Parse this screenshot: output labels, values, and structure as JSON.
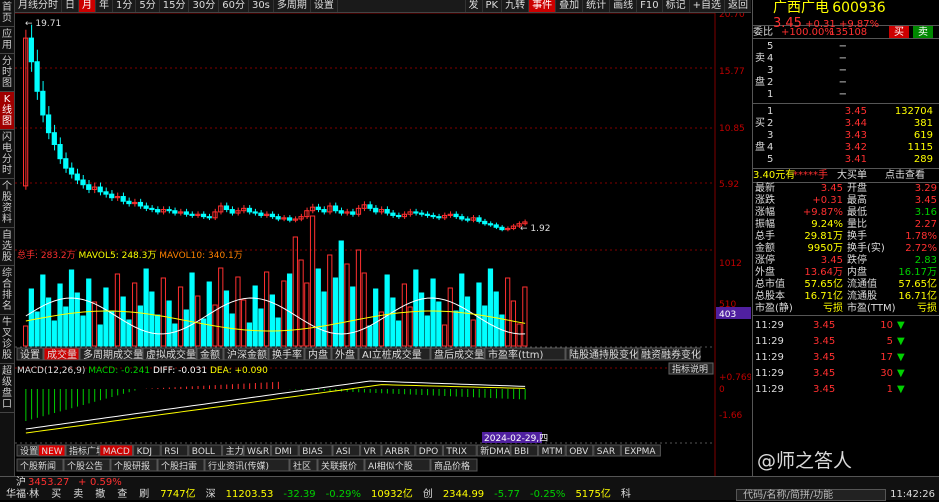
{
  "leftbar": [
    "首页",
    "应用",
    "分时图",
    "K线图",
    "闪电分时",
    "个股资料",
    "自选股",
    "综合排名",
    "牛叉诊股",
    "超级盘口"
  ],
  "toolbar": {
    "left": [
      "月线分时",
      "日",
      "月",
      "年",
      "1分",
      "5分",
      "15分",
      "30分",
      "60分",
      "30s",
      "多周期",
      "设置"
    ],
    "right": [
      "发",
      "PK",
      "九转",
      "事件",
      "叠加",
      "统计",
      "画线",
      "F10",
      "标记",
      "+自选",
      "返回"
    ]
  },
  "price_axis": [
    "20.70",
    "15.77",
    "10.85",
    "5.92"
  ],
  "high_label": "19.71",
  "low_label": "1.92",
  "vol_info": {
    "total": "总手: 283.2万",
    "ma5": "MAVOL5: 248.3万",
    "ma10": "MAVOL10: 340.1万"
  },
  "vol_axis": [
    "1012",
    "510",
    "403"
  ],
  "ind_tabs": [
    "设置",
    "成交量",
    "多周期成交量",
    "虚拟成交量",
    "金额",
    "沪深金额",
    "换手率",
    "内盘",
    "外盘",
    "AI立桩成交量",
    "盘后成交量",
    "市盈率(ttm)",
    "陆股通持股变化",
    "融资融券变化"
  ],
  "macd_info": {
    "title": "MACD(12,26,9)",
    "macd": "MACD: -0.241",
    "diff": "DIFF: -0.031",
    "dea": "DEA: +0.090"
  },
  "macd_axis": [
    "+0.769",
    "0",
    "-1.66"
  ],
  "macd_btn": "指标说明",
  "date_cursor": "2024-02-29,四",
  "bottom_tabs": [
    "设置",
    "NEW",
    "指标广场",
    "MACD",
    "KDJ",
    "RSI",
    "BOLL",
    "主力",
    "W&R",
    "DMI",
    "BIAS",
    "ASI",
    "VR",
    "ARBR",
    "DPO",
    "TRIX",
    "新DMA",
    "BBI",
    "MTM",
    "OBV",
    "SAR",
    "EXPMA"
  ],
  "news_tabs": [
    "个股新闻",
    "个股公告",
    "个股研报",
    "个股扫雷",
    "行业资讯(传媒)",
    "社区",
    "关联报价",
    "AI相似个股",
    "商品价格"
  ],
  "stock": {
    "name": "广西广电",
    "code": "600936",
    "price": "3.45",
    "change": "+0.31",
    "pct": "+9.87%"
  },
  "order": {
    "label": "委比",
    "ratio": "+100.00%",
    "diff": "135108",
    "buy": "买",
    "sell": "卖"
  },
  "asks": [
    [
      "5",
      "",
      ""
    ],
    [
      "4",
      "",
      ""
    ],
    [
      "3",
      "",
      ""
    ],
    [
      "2",
      "",
      ""
    ],
    [
      "1",
      "",
      ""
    ]
  ],
  "ask_mark": "−",
  "bids": [
    [
      "1",
      "3.45",
      "132704"
    ],
    [
      "2",
      "3.44",
      "381"
    ],
    [
      "3",
      "3.43",
      "619"
    ],
    [
      "4",
      "3.42",
      "1115"
    ],
    [
      "5",
      "3.41",
      "289"
    ]
  ],
  "side_sell": [
    "卖",
    "盘"
  ],
  "side_buy": [
    "买",
    "盘"
  ],
  "buy_row": {
    "a": "3.40元有",
    "b": "*****手",
    "c": "大买单",
    "d": "点击查看"
  },
  "stats": [
    [
      "最新",
      "3.45",
      "开盘",
      "3.29"
    ],
    [
      "涨跌",
      "+0.31",
      "最高",
      "3.45"
    ],
    [
      "涨幅",
      "+9.87%",
      "最低",
      "3.16"
    ],
    [
      "振幅",
      "9.24%",
      "量比",
      "2.27"
    ],
    [
      "总手",
      "29.81万",
      "换手",
      "1.78%"
    ],
    [
      "金额",
      "9950万",
      "换手(实)",
      "2.72%"
    ],
    [
      "涨停",
      "3.45",
      "跌停",
      "2.83"
    ],
    [
      "外盘",
      "13.64万",
      "内盘",
      "16.17万"
    ],
    [
      "总市值",
      "57.65亿",
      "流通值",
      "57.65亿"
    ],
    [
      "总股本",
      "16.71亿",
      "流通股",
      "16.71亿"
    ],
    [
      "市盈(静)",
      "亏损",
      "市盈(TTM)",
      "亏损"
    ]
  ],
  "ticks": [
    [
      "11:29",
      "3.45",
      "10"
    ],
    [
      "11:29",
      "3.45",
      "5"
    ],
    [
      "11:29",
      "3.45",
      "17"
    ],
    [
      "11:29",
      "3.45",
      "30"
    ],
    [
      "11:29",
      "3.45",
      "1"
    ]
  ],
  "watermark": "@师之答人",
  "status": {
    "row1": [
      "沪",
      "3453.27",
      "+",
      "0.59%"
    ],
    "row2a": [
      "华福·林",
      "买",
      "卖",
      "撤",
      "查",
      "刷"
    ],
    "row2b": [
      "7747亿",
      "深",
      "11203.53",
      "-32.39",
      "-0.29%",
      "10932亿",
      "创",
      "2344.99",
      "-5.77",
      "-0.25%",
      "5175亿",
      "科"
    ],
    "search": "代码/名称/简拼/功能",
    "time": "11:42:26"
  },
  "colors": {
    "up": "#ff3030",
    "down": "#00ffff",
    "ma5": "#ffffff",
    "ma10": "#ffff00",
    "ma20": "#ff00ff",
    "grid": "#800000"
  }
}
